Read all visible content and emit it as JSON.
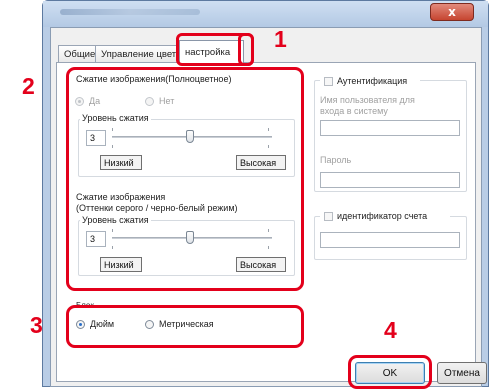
{
  "window": {
    "close_glyph": "x"
  },
  "tabs": [
    {
      "label": "Общие"
    },
    {
      "label": "Управление цветом"
    },
    {
      "label": "настройка"
    }
  ],
  "compression_color": {
    "title": "Сжатие изображения(Полноцветное)",
    "options": [
      "Да",
      "Нет"
    ],
    "selected": "Да",
    "level_title": "Уровень сжатия",
    "level_value": "3",
    "low_label": "Низкий",
    "high_label": "Высокая"
  },
  "compression_gray": {
    "title_line1": "Сжатие изображения",
    "title_line2": "(Оттенки серого / черно-белый режим)",
    "level_title": "Уровень сжатия",
    "level_value": "3",
    "low_label": "Низкий",
    "high_label": "Высокая"
  },
  "auth": {
    "checkbox_label": "Аутентификация",
    "username_label_1": "Имя пользователя для",
    "username_label_2": "входа в систему",
    "password_label": "Пароль"
  },
  "account": {
    "checkbox_label": "идентификатор счета"
  },
  "units": {
    "title": "Блок",
    "options": [
      "Дюйм",
      "Метрическая"
    ],
    "selected": "Дюйм"
  },
  "buttons": {
    "ok": "OK",
    "cancel": "Отмена"
  },
  "callouts": [
    "1",
    "2",
    "3",
    "4"
  ],
  "colors": {
    "highlight": "#e3001b"
  }
}
